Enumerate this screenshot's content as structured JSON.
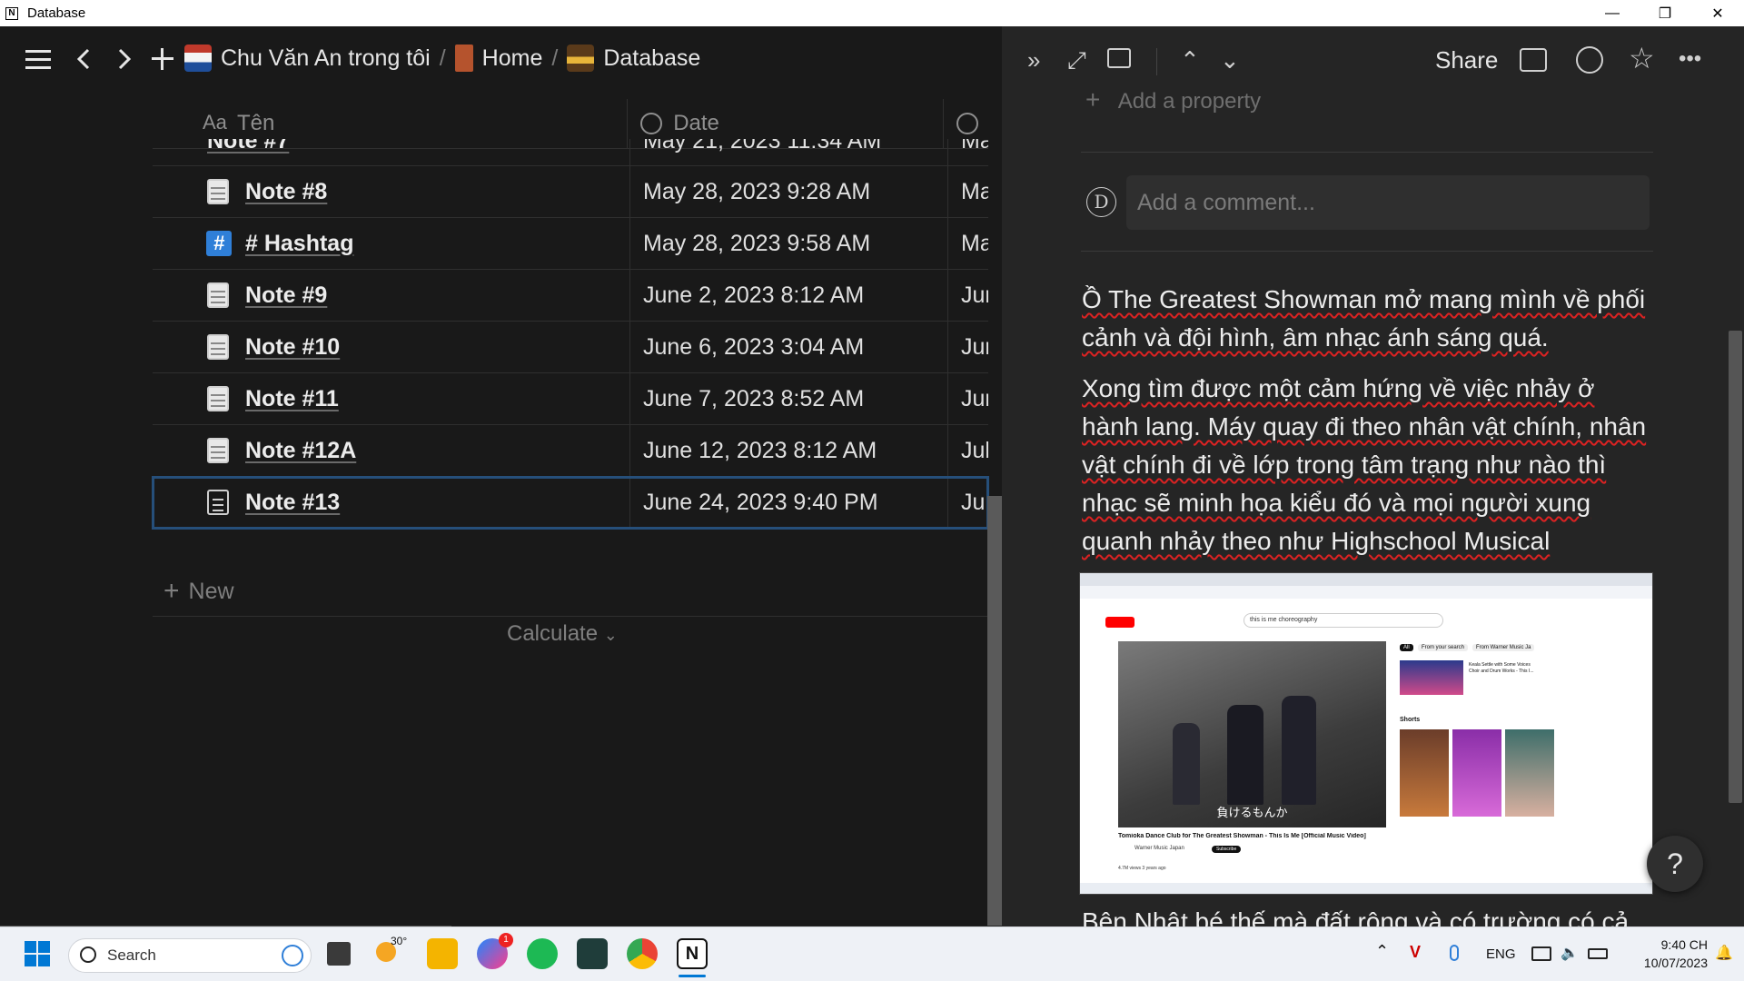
{
  "window": {
    "title": "Database",
    "app_icon": "N"
  },
  "breadcrumb": {
    "items": [
      {
        "label": "Chu Văn An trong tôi"
      },
      {
        "label": "Home"
      },
      {
        "label": "Database"
      }
    ],
    "separator": "/"
  },
  "table": {
    "columns": {
      "name_prefix": "Aa",
      "name": "Tên",
      "date": "Date"
    },
    "partial_row": {
      "name": "Note #7",
      "date": "May 21, 2023 11:34 AM",
      "extra": "Ma"
    },
    "rows": [
      {
        "name": "Note #8",
        "date": "May 28, 2023 9:28 AM",
        "extra": "Ma",
        "icon": "notepad-icon"
      },
      {
        "name": "# Hashtag",
        "date": "May 28, 2023 9:58 AM",
        "extra": "Ma",
        "icon": "hashtag-icon"
      },
      {
        "name": "Note #9",
        "date": "June 2, 2023 8:12 AM",
        "extra": "Jur",
        "icon": "notepad-icon"
      },
      {
        "name": "Note #10",
        "date": "June 6, 2023 3:04 AM",
        "extra": "Jur",
        "icon": "notepad-icon"
      },
      {
        "name": "Note #11",
        "date": "June 7, 2023 8:52 AM",
        "extra": "Jur",
        "icon": "notepad-icon"
      },
      {
        "name": "Note #12A",
        "date": "June 12, 2023 8:12 AM",
        "extra": "Jul",
        "icon": "notepad-icon"
      },
      {
        "name": "Note #13",
        "date": "June 24, 2023 9:40 PM",
        "extra": "Jur",
        "icon": "page-icon"
      }
    ],
    "new_label": "New",
    "calculate_label": "Calculate"
  },
  "panel": {
    "share_label": "Share",
    "add_property": "Add a property",
    "avatar_letter": "D",
    "comment_placeholder": "Add a comment...",
    "paragraph1": "Ồ The Greatest Showman mở mang mình về phối cảnh và đội hình, âm nhạc ánh sáng quá.",
    "paragraph2": "Xong tìm được một cảm hứng về việc nhảy ở hành lang. Máy quay đi theo nhân vật chính, nhân vật chính đi về lớp trong tâm trạng như nào thì nhạc sẽ minh họa kiểu đó và mọi người xung quanh nhảy theo như Highschool Musical",
    "paragraph3_cut": "Bên Nhật bé thế mà đất rộng và có trường có cả",
    "help_label": "?",
    "embedded": {
      "search_query": "this is me choreography",
      "video_caption": "負けるもんか",
      "video_title": "Tomioka Dance Club for The Greatest Showman - This Is Me [Official Music Video]",
      "channel": "Warner Music Japan",
      "subscribe_label": "Subscribe",
      "views": "4.7M views 3 years ago",
      "shorts_label": "Shorts",
      "chip_all": "All",
      "chip_search": "From your search",
      "chip_warner": "From Warner Music Ja",
      "side_video": "Keala Settle with Some Voices Choir and Drum Works - This I..."
    }
  },
  "taskbar": {
    "search_label": "Search",
    "weather": "30°",
    "badge": "1",
    "lang": "ENG",
    "time": "9:40 CH",
    "date": "10/07/2023"
  },
  "colors": {
    "bg_left": "#191919",
    "bg_right": "#252525",
    "accent_blue": "#2f7fd8",
    "spell_red": "#dd2222"
  }
}
